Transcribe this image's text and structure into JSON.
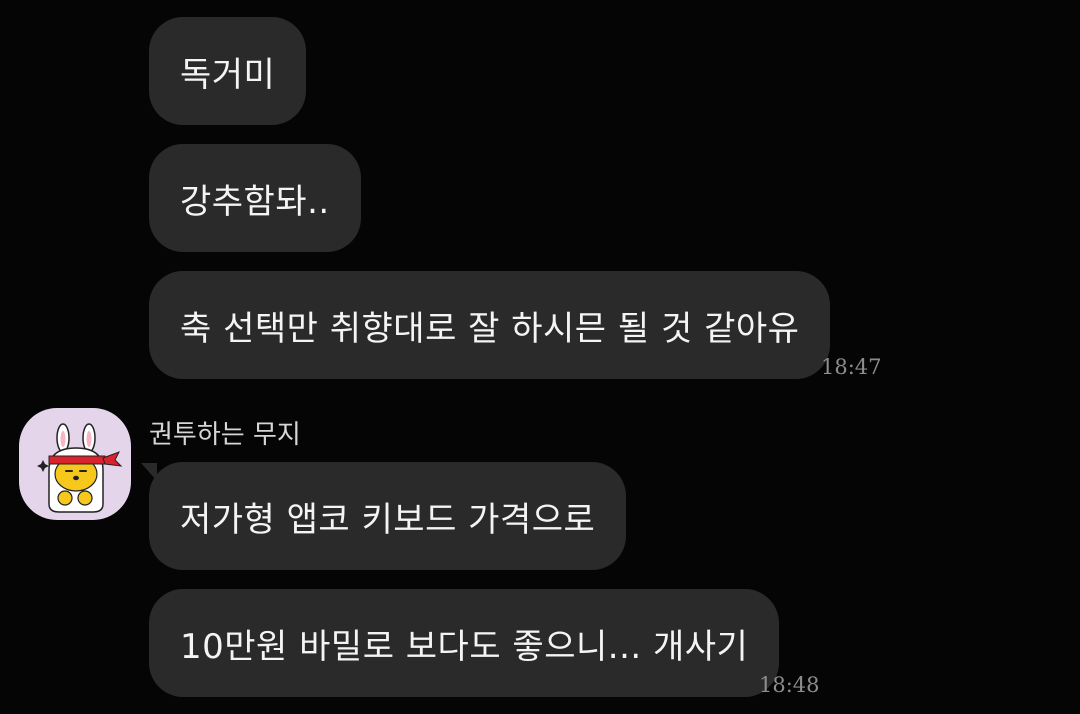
{
  "messages": [
    {
      "text": "독거미"
    },
    {
      "text": "강추함돠.."
    },
    {
      "text": "축 선택만 취향대로 잘 하시믄 될 것 같아유",
      "time": "18:47"
    },
    {
      "text": "저가형 앱코 키보드 가격으로"
    },
    {
      "text": "10만원 바밀로 보다도 좋으니... 개사기",
      "time": "18:48"
    }
  ],
  "sender": {
    "name": "권투하는 무지",
    "avatar_icon": "boxing-rabbit-muzi-icon"
  },
  "colors": {
    "background": "#050505",
    "bubble": "#2a2a2a",
    "text": "#f4f4f4",
    "time": "#8d8d8d",
    "avatar_bg": "#e4d5ea"
  }
}
